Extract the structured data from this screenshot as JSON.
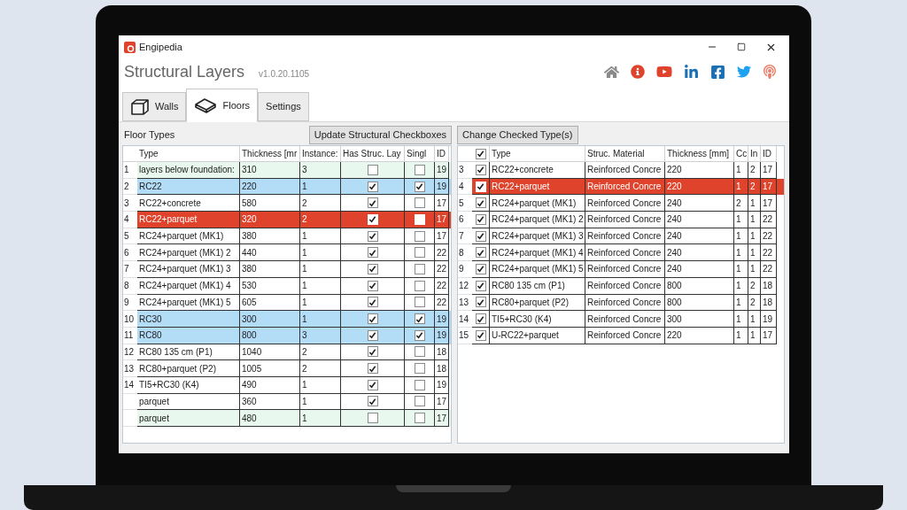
{
  "window": {
    "app_name": "Engipedia",
    "title": "Structural Layers",
    "version": "v1.0.20.1105"
  },
  "tabs": [
    {
      "label": "Walls",
      "kind": "wall",
      "selected": false
    },
    {
      "label": "Floors",
      "kind": "floor",
      "selected": true
    },
    {
      "label": "Settings",
      "selected": false
    }
  ],
  "left_panel": {
    "title": "Floor Types",
    "button": "Update Structural Checkboxes",
    "columns": [
      "Type",
      "Thickness [mr",
      "Instance:",
      "Has Struc. Lay",
      "Singl",
      "ID"
    ],
    "rows": [
      {
        "number": "1",
        "type": "layers below foundation:",
        "thickness": "310",
        "instances": "3",
        "has_struc": false,
        "single": false,
        "id": "19",
        "color": "#e8f8ee",
        "selected": false
      },
      {
        "number": "2",
        "type": "RC22",
        "thickness": "220",
        "instances": "1",
        "has_struc": true,
        "single": true,
        "id": "19",
        "color": "#b3dcf7",
        "selected": false
      },
      {
        "number": "3",
        "type": "RC22+concrete",
        "thickness": "580",
        "instances": "2",
        "has_struc": true,
        "single": false,
        "id": "17",
        "color": "#ffffff",
        "selected": false
      },
      {
        "number": "4",
        "type": "RC22+parquet",
        "thickness": "320",
        "instances": "2",
        "has_struc": true,
        "single": false,
        "id": "17",
        "selected": true
      },
      {
        "number": "5",
        "type": "RC24+parquet (MK1)",
        "thickness": "380",
        "instances": "1",
        "has_struc": true,
        "single": false,
        "id": "17",
        "color": "#ffffff",
        "selected": false
      },
      {
        "number": "6",
        "type": "RC24+parquet (MK1) 2",
        "thickness": "440",
        "instances": "1",
        "has_struc": true,
        "single": false,
        "id": "22",
        "color": "#ffffff",
        "selected": false
      },
      {
        "number": "7",
        "type": "RC24+parquet (MK1) 3",
        "thickness": "380",
        "instances": "1",
        "has_struc": true,
        "single": false,
        "id": "22",
        "color": "#ffffff",
        "selected": false
      },
      {
        "number": "8",
        "type": "RC24+parquet (MK1) 4",
        "thickness": "530",
        "instances": "1",
        "has_struc": true,
        "single": false,
        "id": "22",
        "color": "#ffffff",
        "selected": false
      },
      {
        "number": "9",
        "type": "RC24+parquet (MK1) 5",
        "thickness": "605",
        "instances": "1",
        "has_struc": true,
        "single": false,
        "id": "22",
        "color": "#ffffff",
        "selected": false
      },
      {
        "number": "10",
        "type": "RC30",
        "thickness": "300",
        "instances": "1",
        "has_struc": true,
        "single": true,
        "id": "19",
        "color": "#b3dcf7",
        "selected": false
      },
      {
        "number": "11",
        "type": "RC80",
        "thickness": "800",
        "instances": "3",
        "has_struc": true,
        "single": true,
        "id": "19",
        "color": "#b3dcf7",
        "selected": false
      },
      {
        "number": "12",
        "type": "RC80 135 cm (P1)",
        "thickness": "1040",
        "instances": "2",
        "has_struc": true,
        "single": false,
        "id": "18",
        "color": "#ffffff",
        "selected": false
      },
      {
        "number": "13",
        "type": "RC80+parquet (P2)",
        "thickness": "1005",
        "instances": "2",
        "has_struc": true,
        "single": false,
        "id": "18",
        "color": "#ffffff",
        "selected": false
      },
      {
        "number": "14",
        "type": "TI5+RC30 (K4)",
        "thickness": "490",
        "instances": "1",
        "has_struc": true,
        "single": false,
        "id": "19",
        "color": "#ffffff",
        "selected": false
      },
      {
        "type": "parquet",
        "thickness": "360",
        "instances": "1",
        "has_struc": true,
        "single": false,
        "id": "17",
        "color": "#ffffff",
        "selected": false
      },
      {
        "type": "parquet",
        "thickness": "480",
        "instances": "1",
        "has_struc": false,
        "single": false,
        "id": "17",
        "color": "#e8f8ee",
        "selected": false
      }
    ]
  },
  "right_panel": {
    "button": "Change Checked Type(s)",
    "header_checked": true,
    "columns": [
      "Type",
      "Struc. Material",
      "Thickness [mm]",
      "Cc",
      "In",
      "ID"
    ],
    "rows": [
      {
        "number": "3",
        "checked": true,
        "type": "RC22+concrete",
        "material": "Reinforced Concre",
        "thickness": "220",
        "cc": "1",
        "in": "2",
        "id": "17",
        "selected": false
      },
      {
        "number": "4",
        "checked": true,
        "type": "RC22+parquet",
        "material": "Reinforced Concre",
        "thickness": "220",
        "cc": "1",
        "in": "2",
        "id": "17",
        "selected": true
      },
      {
        "number": "5",
        "checked": true,
        "type": "RC24+parquet (MK1)",
        "material": "Reinforced Concre",
        "thickness": "240",
        "cc": "2",
        "in": "1",
        "id": "17",
        "selected": false
      },
      {
        "number": "6",
        "checked": true,
        "type": "RC24+parquet (MK1) 2",
        "material": "Reinforced Concre",
        "thickness": "240",
        "cc": "1",
        "in": "1",
        "id": "22",
        "selected": false
      },
      {
        "number": "7",
        "checked": true,
        "type": "RC24+parquet (MK1) 3",
        "material": "Reinforced Concre",
        "thickness": "240",
        "cc": "1",
        "in": "1",
        "id": "22",
        "selected": false
      },
      {
        "number": "8",
        "checked": true,
        "type": "RC24+parquet (MK1) 4",
        "material": "Reinforced Concre",
        "thickness": "240",
        "cc": "1",
        "in": "1",
        "id": "22",
        "selected": false
      },
      {
        "number": "9",
        "checked": true,
        "type": "RC24+parquet (MK1) 5",
        "material": "Reinforced Concre",
        "thickness": "240",
        "cc": "1",
        "in": "1",
        "id": "22",
        "selected": false
      },
      {
        "number": "12",
        "checked": true,
        "type": "RC80 135 cm (P1)",
        "material": "Reinforced Concre",
        "thickness": "800",
        "cc": "1",
        "in": "2",
        "id": "18",
        "selected": false
      },
      {
        "number": "13",
        "checked": true,
        "type": "RC80+parquet (P2)",
        "material": "Reinforced Concre",
        "thickness": "800",
        "cc": "1",
        "in": "2",
        "id": "18",
        "selected": false
      },
      {
        "number": "14",
        "checked": true,
        "type": "TI5+RC30 (K4)",
        "material": "Reinforced Concre",
        "thickness": "300",
        "cc": "1",
        "in": "1",
        "id": "19",
        "selected": false
      },
      {
        "number": "15",
        "checked": true,
        "type": "U-RC22+parquet",
        "material": "Reinforced Concre",
        "thickness": "220",
        "cc": "1",
        "in": "1",
        "id": "17",
        "selected": false
      }
    ]
  }
}
